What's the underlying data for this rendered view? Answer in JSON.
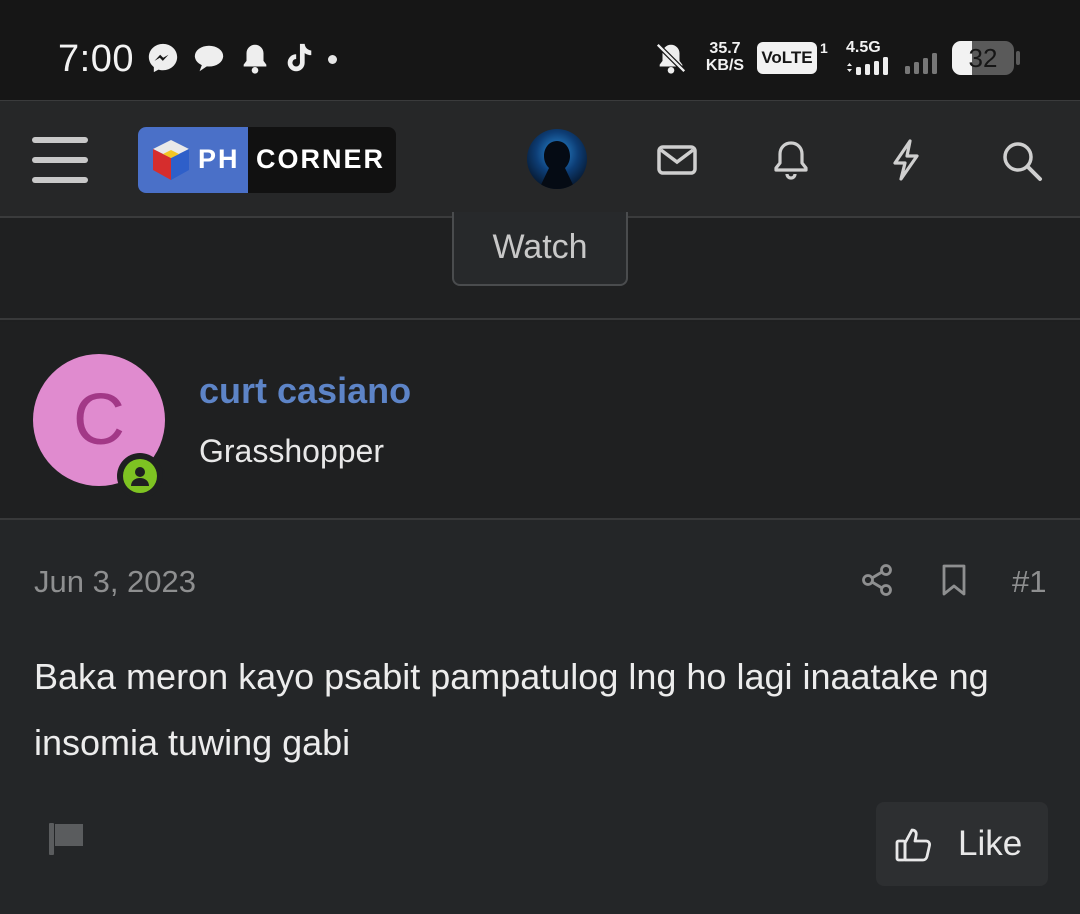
{
  "status_bar": {
    "time": "7:00",
    "net_speed_value": "35.7",
    "net_speed_unit": "KB/S",
    "volte": "VoLTE",
    "volte_sim": "1",
    "network": "4.5G",
    "battery": "32",
    "battery_level_percent": 32,
    "icons": [
      "messenger-icon",
      "chat-bubble-icon",
      "notification-bell-icon",
      "tiktok-icon",
      "bell-muted-icon",
      "signal-icon"
    ]
  },
  "header": {
    "logo_ph": "PH",
    "logo_corner": "CORNER",
    "icons": [
      "hamburger-menu-icon",
      "user-avatar",
      "inbox-icon",
      "alerts-bell-icon",
      "whats-new-icon",
      "search-icon"
    ]
  },
  "thread": {
    "watch_label": "Watch"
  },
  "post": {
    "author_initial": "C",
    "author_name": "curt casiano",
    "author_title": "Grasshopper",
    "date": "Jun 3, 2023",
    "post_number": "#1",
    "text": "Baka meron kayo psabit pampatulog lng ho lagi inaatake ng insomia tuwing gabi",
    "like_label": "Like",
    "colors": {
      "username": "#5d84c7",
      "avatar_bg": "#e08bcf",
      "avatar_letter": "#a23887",
      "online": "#7ec322"
    }
  }
}
